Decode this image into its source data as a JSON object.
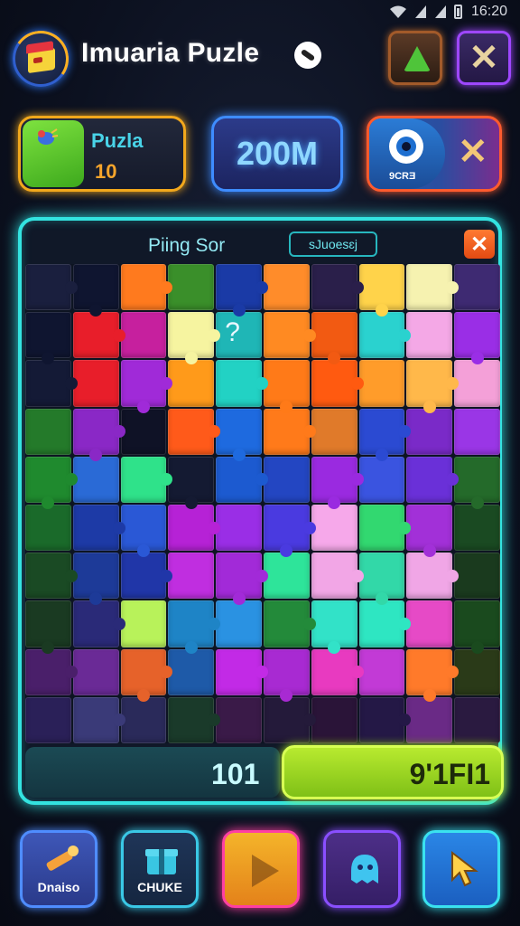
{
  "status_bar": {
    "time": "16:20"
  },
  "header": {
    "title": "Imuaria Puzle",
    "icon_names": [
      "app-logo-icon",
      "link-badge-icon",
      "alert-bell-icon",
      "close-icon"
    ],
    "close_glyph": "✕"
  },
  "stats": {
    "puzzle": {
      "label": "Puzla",
      "value": "10",
      "icon": "bug-icon"
    },
    "score": {
      "value": "200M"
    },
    "boost": {
      "label": "9CRƎ",
      "x_glyph": "✕",
      "icon": "eye-icon"
    }
  },
  "board": {
    "title": "Piing Sor",
    "tag": "sJuoesɛj",
    "close_glyph": "✕",
    "hint": "?",
    "rows": [
      [
        "#1a1f3e",
        "#0f1530",
        "#ff7a1e",
        "#3a8f2a",
        "#1a3aa6",
        "#ff8c2a",
        "#2a1f4a",
        "#ffd34a",
        "#f6f2b0",
        "#3e2a72"
      ],
      [
        "#0f1530",
        "#e81e2a",
        "#c6209e",
        "#f6f4a0",
        "#1fb6b6",
        "#ff8a22",
        "#f25a12",
        "#2ad2cf",
        "#f4a8e6",
        "#9a2ee6"
      ],
      [
        "#141a36",
        "#e81e2a",
        "#a02ad8",
        "#ff9a1a",
        "#22d2c4",
        "#ff7a18",
        "#ff5a10",
        "#ff9c2a",
        "#ffb84a",
        "#f4a0d8"
      ],
      [
        "#247a2a",
        "#8a28c6",
        "#0f1226",
        "#ff5a1a",
        "#1e6adf",
        "#ff7a1a",
        "#e07a2a",
        "#2b4ad2",
        "#7a2ac8",
        "#9a36e6"
      ],
      [
        "#1f8a2e",
        "#2a6ad6",
        "#2fe28a",
        "#141a32",
        "#1c5ad0",
        "#2346c2",
        "#9a2ae0",
        "#3a54e0",
        "#6a30d8",
        "#246a2a"
      ],
      [
        "#1a6a2a",
        "#1d3aa6",
        "#2a58d6",
        "#b622d6",
        "#9a2ee6",
        "#4a3ae0",
        "#f6a8ea",
        "#32d870",
        "#a230d8",
        "#1a4a22"
      ],
      [
        "#1a4a24",
        "#1d3a98",
        "#2036a8",
        "#c02ee0",
        "#a22ad8",
        "#2ee49a",
        "#f2a6e6",
        "#32d8a8",
        "#f0a6e6",
        "#1a3a1e"
      ],
      [
        "#1a3a22",
        "#2a2a78",
        "#b8f25a",
        "#1e84c6",
        "#2a92e2",
        "#238a3a",
        "#32e2c8",
        "#2ee6c2",
        "#e64ac6",
        "#1a4a1e"
      ],
      [
        "#4a1f6a",
        "#6a2a96",
        "#e6622a",
        "#1e5aa8",
        "#c22ae6",
        "#a82ad2",
        "#e83ac0",
        "#c23ad6",
        "#ff7a2a",
        "#2a3a18"
      ],
      [
        "#2a2058",
        "#3a3a78",
        "#2a2a5a",
        "#1a3a2a",
        "#3a1a48",
        "#241a3a",
        "#2a1438",
        "#241846",
        "#6a2a86",
        "#2a1a40"
      ]
    ],
    "pieces_placed": "101",
    "timer": "9'1FI1"
  },
  "toolbar": [
    {
      "label": "Dnaiso",
      "icon": "brush-icon"
    },
    {
      "label": "CHUKE",
      "icon": "gift-icon"
    },
    {
      "label": "",
      "icon": "play-icon"
    },
    {
      "label": "",
      "icon": "ghost-icon"
    },
    {
      "label": "",
      "icon": "pointer-icon"
    }
  ],
  "colors": {
    "panel_border": "#33e3e0",
    "accent_orange": "#f2a81c",
    "accent_blue": "#3e8cff",
    "accent_purple": "#9e47ff",
    "timer_green": "#b8ea2f"
  }
}
